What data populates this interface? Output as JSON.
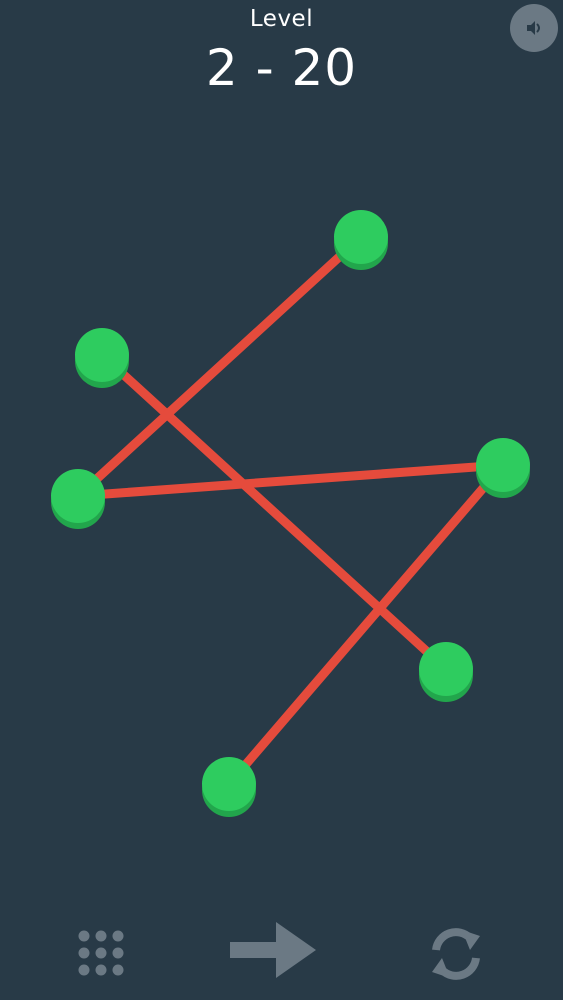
{
  "header": {
    "level_label": "Level",
    "level_number": "2 - 20"
  },
  "buttons": {
    "sound_icon": "speaker-icon",
    "menu_icon": "grid-icon",
    "next_icon": "arrow-right-icon",
    "restart_icon": "refresh-icon"
  },
  "colors": {
    "background": "#283a47",
    "line": "#e54b3c",
    "node": "#2ecc5f",
    "node_shadow": "#22a64c",
    "button_muted": "#6b7984"
  },
  "graph": {
    "node_count": 6,
    "edges": [
      [
        "node-left-upper",
        "node-right-lower"
      ],
      [
        "node-left-middle",
        "node-top"
      ],
      [
        "node-left-middle",
        "node-right-upper"
      ],
      [
        "node-right-upper",
        "node-bottom"
      ]
    ]
  }
}
